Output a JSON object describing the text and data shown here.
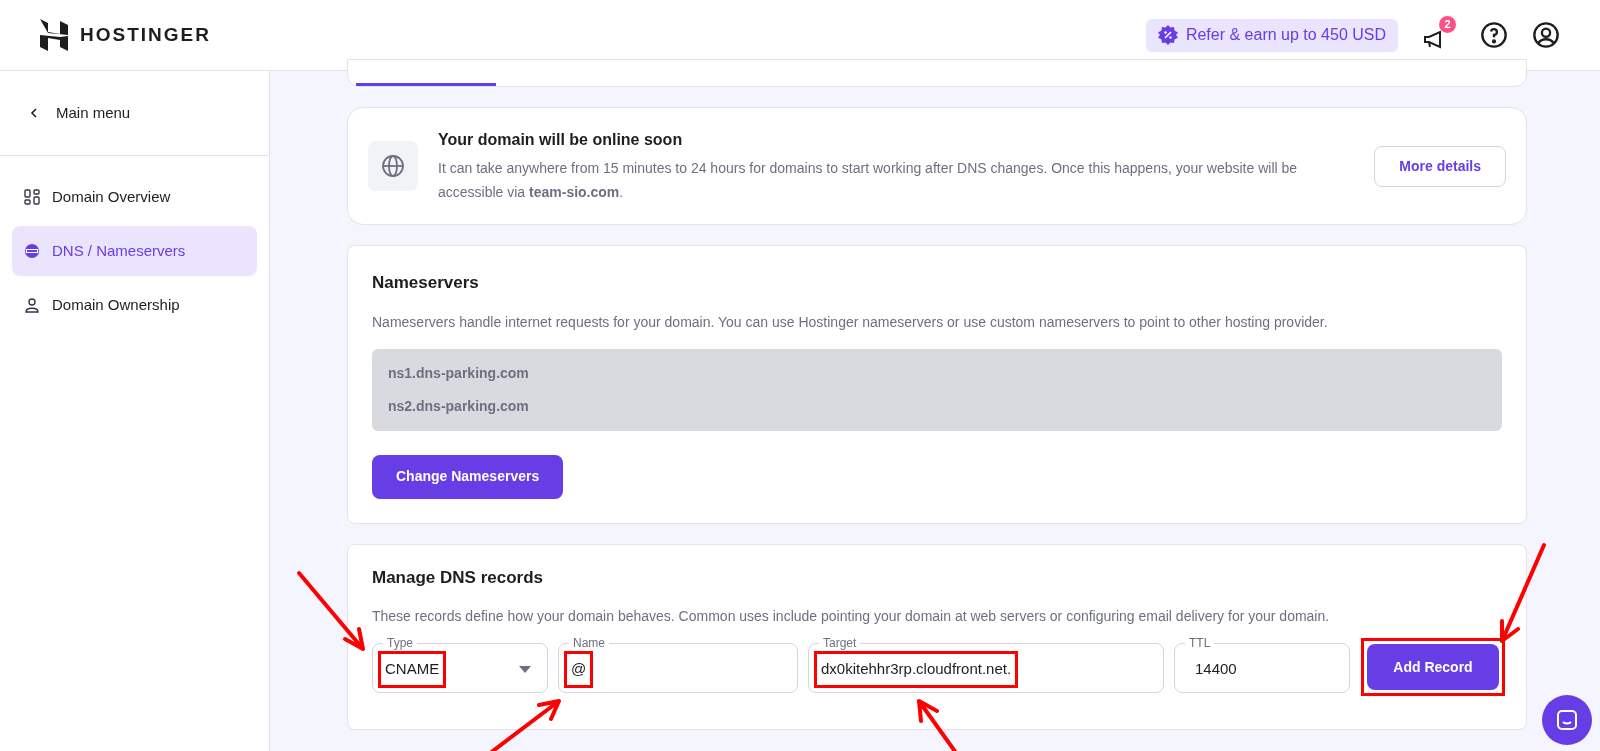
{
  "header": {
    "brand": "HOSTINGER",
    "referral": "Refer & earn up to 450 USD",
    "notifications_badge": "2"
  },
  "sidebar": {
    "back": "Main menu",
    "items": [
      {
        "label": "Domain Overview",
        "selected": false
      },
      {
        "label": "DNS / Nameservers",
        "selected": true
      },
      {
        "label": "Domain Ownership",
        "selected": false
      }
    ]
  },
  "notice": {
    "title": "Your domain will be online soon",
    "text": "It can take anywhere from 15 minutes to 24 hours for domains to start working after DNS changes. Once this happens, your website will be accessible via **team-sio.com**.",
    "button": "More details"
  },
  "nameservers": {
    "title": "Nameservers",
    "description": "Nameservers handle internet requests for your domain. You can use Hostinger nameservers or use custom nameservers to point to other hosting provider.",
    "servers": [
      "ns1.dns-parking.com",
      "ns2.dns-parking.com"
    ],
    "button": "Change Nameservers"
  },
  "dns": {
    "title": "Manage DNS records",
    "description": "These records define how your domain behaves. Common uses include pointing your domain at web servers or configuring email delivery for your domain.",
    "fields": [
      {
        "kind": "select",
        "label": "Type",
        "value": "CNAME",
        "highlighted": true
      },
      {
        "kind": "input",
        "label": "Name",
        "value": "@",
        "highlighted": true
      },
      {
        "kind": "input",
        "label": "Target",
        "value": "dx0kitehhr3rp.cloudfront.net.",
        "highlighted": true
      },
      {
        "kind": "input",
        "label": "TTL",
        "value": "14400",
        "highlighted": false
      }
    ],
    "button": {
      "label": "Add Record",
      "highlighted": true
    }
  }
}
